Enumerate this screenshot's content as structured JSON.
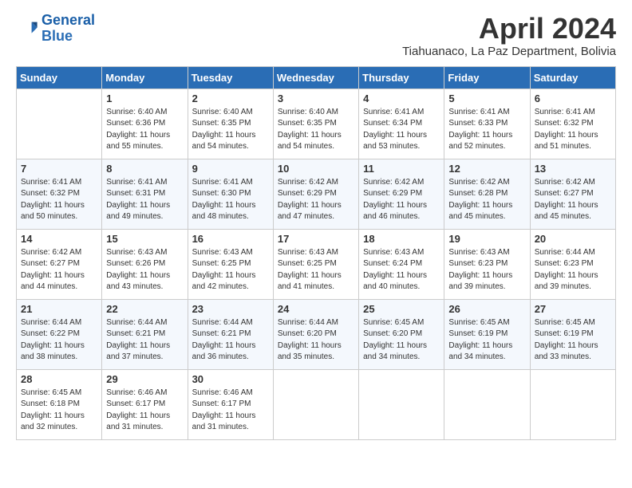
{
  "header": {
    "logo_line1": "General",
    "logo_line2": "Blue",
    "month": "April 2024",
    "location": "Tiahuanaco, La Paz Department, Bolivia"
  },
  "weekdays": [
    "Sunday",
    "Monday",
    "Tuesday",
    "Wednesday",
    "Thursday",
    "Friday",
    "Saturday"
  ],
  "weeks": [
    [
      {
        "day": "",
        "info": ""
      },
      {
        "day": "1",
        "info": "Sunrise: 6:40 AM\nSunset: 6:36 PM\nDaylight: 11 hours\nand 55 minutes."
      },
      {
        "day": "2",
        "info": "Sunrise: 6:40 AM\nSunset: 6:35 PM\nDaylight: 11 hours\nand 54 minutes."
      },
      {
        "day": "3",
        "info": "Sunrise: 6:40 AM\nSunset: 6:35 PM\nDaylight: 11 hours\nand 54 minutes."
      },
      {
        "day": "4",
        "info": "Sunrise: 6:41 AM\nSunset: 6:34 PM\nDaylight: 11 hours\nand 53 minutes."
      },
      {
        "day": "5",
        "info": "Sunrise: 6:41 AM\nSunset: 6:33 PM\nDaylight: 11 hours\nand 52 minutes."
      },
      {
        "day": "6",
        "info": "Sunrise: 6:41 AM\nSunset: 6:32 PM\nDaylight: 11 hours\nand 51 minutes."
      }
    ],
    [
      {
        "day": "7",
        "info": "Sunrise: 6:41 AM\nSunset: 6:32 PM\nDaylight: 11 hours\nand 50 minutes."
      },
      {
        "day": "8",
        "info": "Sunrise: 6:41 AM\nSunset: 6:31 PM\nDaylight: 11 hours\nand 49 minutes."
      },
      {
        "day": "9",
        "info": "Sunrise: 6:41 AM\nSunset: 6:30 PM\nDaylight: 11 hours\nand 48 minutes."
      },
      {
        "day": "10",
        "info": "Sunrise: 6:42 AM\nSunset: 6:29 PM\nDaylight: 11 hours\nand 47 minutes."
      },
      {
        "day": "11",
        "info": "Sunrise: 6:42 AM\nSunset: 6:29 PM\nDaylight: 11 hours\nand 46 minutes."
      },
      {
        "day": "12",
        "info": "Sunrise: 6:42 AM\nSunset: 6:28 PM\nDaylight: 11 hours\nand 45 minutes."
      },
      {
        "day": "13",
        "info": "Sunrise: 6:42 AM\nSunset: 6:27 PM\nDaylight: 11 hours\nand 45 minutes."
      }
    ],
    [
      {
        "day": "14",
        "info": "Sunrise: 6:42 AM\nSunset: 6:27 PM\nDaylight: 11 hours\nand 44 minutes."
      },
      {
        "day": "15",
        "info": "Sunrise: 6:43 AM\nSunset: 6:26 PM\nDaylight: 11 hours\nand 43 minutes."
      },
      {
        "day": "16",
        "info": "Sunrise: 6:43 AM\nSunset: 6:25 PM\nDaylight: 11 hours\nand 42 minutes."
      },
      {
        "day": "17",
        "info": "Sunrise: 6:43 AM\nSunset: 6:25 PM\nDaylight: 11 hours\nand 41 minutes."
      },
      {
        "day": "18",
        "info": "Sunrise: 6:43 AM\nSunset: 6:24 PM\nDaylight: 11 hours\nand 40 minutes."
      },
      {
        "day": "19",
        "info": "Sunrise: 6:43 AM\nSunset: 6:23 PM\nDaylight: 11 hours\nand 39 minutes."
      },
      {
        "day": "20",
        "info": "Sunrise: 6:44 AM\nSunset: 6:23 PM\nDaylight: 11 hours\nand 39 minutes."
      }
    ],
    [
      {
        "day": "21",
        "info": "Sunrise: 6:44 AM\nSunset: 6:22 PM\nDaylight: 11 hours\nand 38 minutes."
      },
      {
        "day": "22",
        "info": "Sunrise: 6:44 AM\nSunset: 6:21 PM\nDaylight: 11 hours\nand 37 minutes."
      },
      {
        "day": "23",
        "info": "Sunrise: 6:44 AM\nSunset: 6:21 PM\nDaylight: 11 hours\nand 36 minutes."
      },
      {
        "day": "24",
        "info": "Sunrise: 6:44 AM\nSunset: 6:20 PM\nDaylight: 11 hours\nand 35 minutes."
      },
      {
        "day": "25",
        "info": "Sunrise: 6:45 AM\nSunset: 6:20 PM\nDaylight: 11 hours\nand 34 minutes."
      },
      {
        "day": "26",
        "info": "Sunrise: 6:45 AM\nSunset: 6:19 PM\nDaylight: 11 hours\nand 34 minutes."
      },
      {
        "day": "27",
        "info": "Sunrise: 6:45 AM\nSunset: 6:19 PM\nDaylight: 11 hours\nand 33 minutes."
      }
    ],
    [
      {
        "day": "28",
        "info": "Sunrise: 6:45 AM\nSunset: 6:18 PM\nDaylight: 11 hours\nand 32 minutes."
      },
      {
        "day": "29",
        "info": "Sunrise: 6:46 AM\nSunset: 6:17 PM\nDaylight: 11 hours\nand 31 minutes."
      },
      {
        "day": "30",
        "info": "Sunrise: 6:46 AM\nSunset: 6:17 PM\nDaylight: 11 hours\nand 31 minutes."
      },
      {
        "day": "",
        "info": ""
      },
      {
        "day": "",
        "info": ""
      },
      {
        "day": "",
        "info": ""
      },
      {
        "day": "",
        "info": ""
      }
    ]
  ]
}
